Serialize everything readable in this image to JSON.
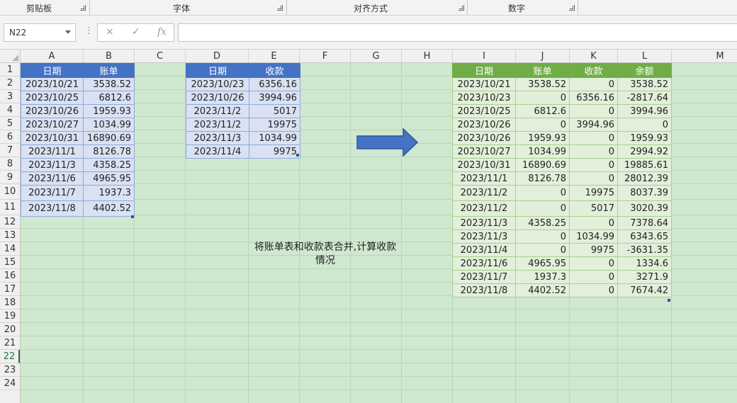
{
  "ribbon": {
    "groups": [
      {
        "label": "剪贴板"
      },
      {
        "label": "字体"
      },
      {
        "label": "对齐方式"
      },
      {
        "label": "数字"
      }
    ]
  },
  "formula_bar": {
    "name_box": "N22",
    "cancel_icon": "×",
    "enter_icon": "✓",
    "fx_label": "fx",
    "formula": ""
  },
  "columns": [
    "A",
    "B",
    "C",
    "D",
    "E",
    "F",
    "G",
    "H",
    "I",
    "J",
    "K",
    "L",
    "M"
  ],
  "rows": [
    "1",
    "2",
    "3",
    "4",
    "5",
    "6",
    "7",
    "8",
    "9",
    "10",
    "11",
    "12",
    "13",
    "14",
    "15",
    "16",
    "17",
    "18",
    "19",
    "20",
    "21",
    "22",
    "23",
    "24"
  ],
  "selected_row": "22",
  "table_bills": {
    "headers": [
      "日期",
      "账单"
    ],
    "rows": [
      [
        "2023/10/21",
        "3538.52"
      ],
      [
        "2023/10/25",
        "6812.6"
      ],
      [
        "2023/10/26",
        "1959.93"
      ],
      [
        "2023/10/27",
        "1034.99"
      ],
      [
        "2023/10/31",
        "16890.69"
      ],
      [
        "2023/11/1",
        "8126.78"
      ],
      [
        "2023/11/3",
        "4358.25"
      ],
      [
        "2023/11/6",
        "4965.95"
      ],
      [
        "2023/11/7",
        "1937.3"
      ],
      [
        "2023/11/8",
        "4402.52"
      ]
    ]
  },
  "table_receipts": {
    "headers": [
      "日期",
      "收款"
    ],
    "rows": [
      [
        "2023/10/23",
        "6356.16"
      ],
      [
        "2023/10/26",
        "3994.96"
      ],
      [
        "2023/11/2",
        "5017"
      ],
      [
        "2023/11/2",
        "19975"
      ],
      [
        "2023/11/3",
        "1034.99"
      ],
      [
        "2023/11/4",
        "9975"
      ]
    ]
  },
  "note": "将账单表和收款表合并,计算收款情况",
  "arrow_color": "#4472c4",
  "table_merged": {
    "headers": [
      "日期",
      "账单",
      "收款",
      "余额"
    ],
    "rows": [
      [
        "2023/10/21",
        "3538.52",
        "0",
        "3538.52"
      ],
      [
        "2023/10/23",
        "0",
        "6356.16",
        "-2817.64"
      ],
      [
        "2023/10/25",
        "6812.6",
        "0",
        "3994.96"
      ],
      [
        "2023/10/26",
        "0",
        "3994.96",
        "0"
      ],
      [
        "2023/10/26",
        "1959.93",
        "0",
        "1959.93"
      ],
      [
        "2023/10/27",
        "1034.99",
        "0",
        "2994.92"
      ],
      [
        "2023/10/31",
        "16890.69",
        "0",
        "19885.61"
      ],
      [
        "2023/11/1",
        "8126.78",
        "0",
        "28012.39"
      ],
      [
        "2023/11/2",
        "0",
        "19975",
        "8037.39"
      ],
      [
        "2023/11/2",
        "0",
        "5017",
        "3020.39"
      ],
      [
        "2023/11/3",
        "4358.25",
        "0",
        "7378.64"
      ],
      [
        "2023/11/3",
        "0",
        "1034.99",
        "6343.65"
      ],
      [
        "2023/11/4",
        "0",
        "9975",
        "-3631.35"
      ],
      [
        "2023/11/6",
        "4965.95",
        "0",
        "1334.6"
      ],
      [
        "2023/11/7",
        "1937.3",
        "0",
        "3271.9"
      ],
      [
        "2023/11/8",
        "4402.52",
        "0",
        "7674.42"
      ]
    ]
  }
}
